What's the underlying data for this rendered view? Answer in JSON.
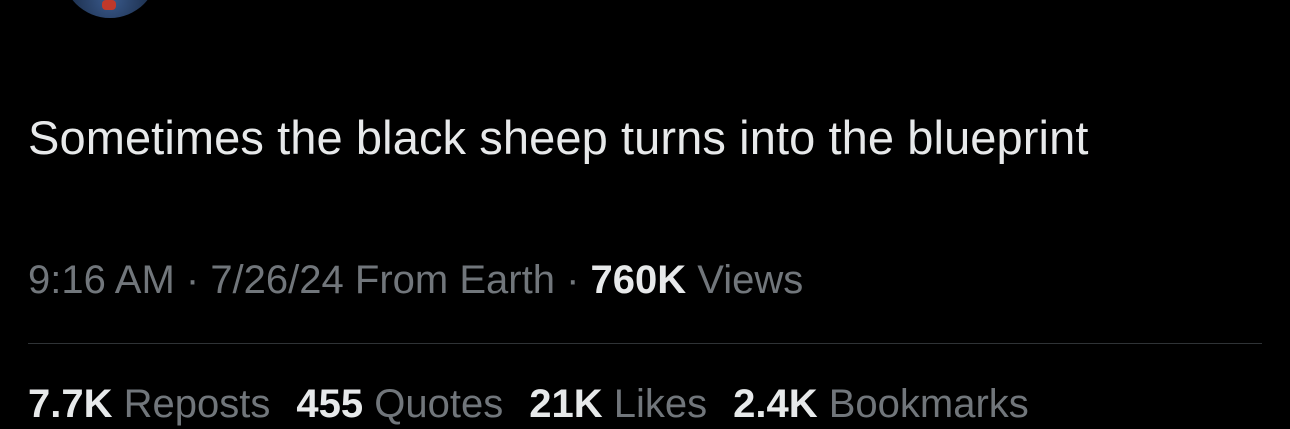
{
  "tweet": {
    "text": "Sometimes the black sheep turns into the blueprint"
  },
  "meta": {
    "time": "9:16 AM",
    "separator": " · ",
    "date": "7/26/24",
    "source": "From Earth",
    "views_count": "760K",
    "views_label": "Views"
  },
  "stats": [
    {
      "count": "7.7K",
      "label": "Reposts"
    },
    {
      "count": "455",
      "label": "Quotes"
    },
    {
      "count": "21K",
      "label": "Likes"
    },
    {
      "count": "2.4K",
      "label": "Bookmarks"
    }
  ],
  "colors": {
    "background": "#000000",
    "primary_text": "#e7e9ea",
    "secondary_text": "#71767b",
    "divider": "#2f3336"
  }
}
